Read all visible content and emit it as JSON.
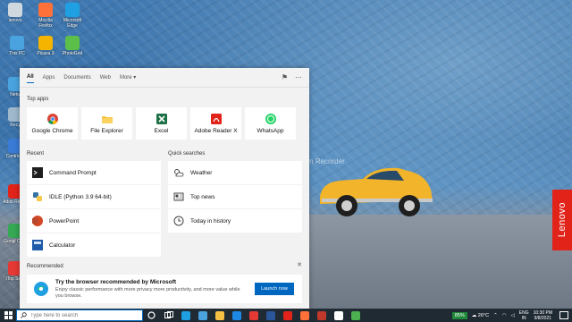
{
  "desktop": {
    "watermark": "Recorded with iTop Screen Recorder",
    "brand": "Lenovo",
    "icons": [
      {
        "label": "lenovo",
        "color": "#cfd8df"
      },
      {
        "label": "Mozilla Firefox",
        "color": "#ff7139"
      },
      {
        "label": "Microsoft Edge",
        "color": "#1fa0e3"
      },
      {
        "label": "This PC",
        "color": "#4aa3df"
      },
      {
        "label": "Picasa 3",
        "color": "#f4b400"
      },
      {
        "label": "PhotoGrid",
        "color": "#5bbf4a"
      },
      {
        "label": "Netw",
        "color": "#4aa3df"
      },
      {
        "label": "Recy",
        "color": "#9fb8cc"
      },
      {
        "label": "Control P",
        "color": "#3a7bd5"
      },
      {
        "label": "Adob Reade",
        "color": "#e2231a"
      },
      {
        "label": "Googl Chro",
        "color": "#34a853"
      },
      {
        "label": "iTop Scre",
        "color": "#e53935"
      }
    ]
  },
  "panel": {
    "tabs": [
      "All",
      "Apps",
      "Documents",
      "Web",
      "More"
    ],
    "top_apps_title": "Top apps",
    "top_apps": [
      {
        "label": "Google Chrome",
        "icon": "chrome-icon",
        "color": "#4285f4"
      },
      {
        "label": "File Explorer",
        "icon": "folder-icon",
        "color": "#f6c143"
      },
      {
        "label": "Excel",
        "icon": "excel-icon",
        "color": "#1d7044"
      },
      {
        "label": "Adobe Reader X",
        "icon": "pdf-icon",
        "color": "#e2231a"
      },
      {
        "label": "WhatsApp",
        "icon": "whatsapp-icon",
        "color": "#25d366"
      }
    ],
    "recent_title": "Recent",
    "recent": [
      {
        "label": "Command Prompt",
        "icon": "cmd-icon",
        "color": "#1e1e1e"
      },
      {
        "label": "IDLE (Python 3.9 64-bit)",
        "icon": "python-icon",
        "color": "#f7c948"
      },
      {
        "label": "PowerPoint",
        "icon": "powerpoint-icon",
        "color": "#d24726"
      },
      {
        "label": "Calculator",
        "icon": "calculator-icon",
        "color": "#1e5aa8"
      }
    ],
    "quick_title": "Quick searches",
    "quick": [
      {
        "label": "Weather",
        "icon": "weather-icon"
      },
      {
        "label": "Top news",
        "icon": "news-icon"
      },
      {
        "label": "Today in history",
        "icon": "clock-icon"
      }
    ],
    "recommended_title": "Recommended",
    "recommended": {
      "title": "Try the browser recommended by Microsoft",
      "description": "Enjoy classic performance with more privacy more productivity, and more value while you browse.",
      "button": "Launch now"
    }
  },
  "taskbar": {
    "search_placeholder": "Type here to search",
    "battery": "85%",
    "temperature": "26°C",
    "language_top": "ENG",
    "language_bottom": "IN",
    "time": "10:30 PM",
    "date": "9/8/2021"
  },
  "colors": {
    "accent": "#0067c0",
    "taskbar": "#202a33"
  }
}
